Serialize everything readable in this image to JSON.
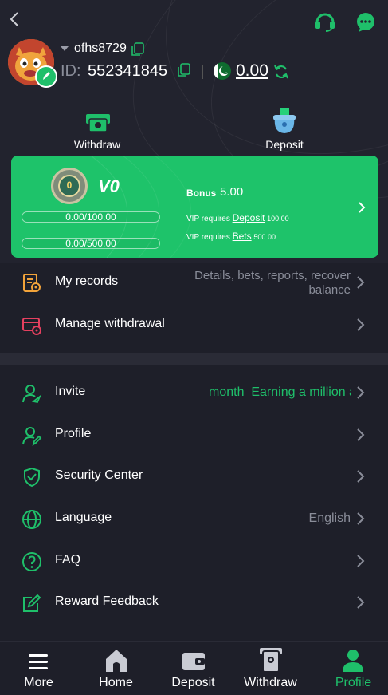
{
  "user": {
    "username": "ofhs8729",
    "id_label": "ID:",
    "id_value": "552341845",
    "balance": "0.00"
  },
  "actions": {
    "withdraw": "Withdraw",
    "deposit": "Deposit"
  },
  "vip": {
    "level": "V0",
    "badge_number": "0",
    "progress_1": "0.00/100.00",
    "progress_2": "0.00/500.00",
    "bonus_label": "Bonus",
    "bonus_value": "5.00",
    "req1_prefix": "VIP requires",
    "req1_link": "Deposit",
    "req1_value": "100.00",
    "req2_prefix": "VIP requires",
    "req2_link": "Bets",
    "req2_value": "500.00"
  },
  "menu1": [
    {
      "label": "My records",
      "extra_line1": "Details, bets, reports, recover",
      "extra_line2": "balance"
    },
    {
      "label": "Manage withdrawal"
    }
  ],
  "menu2": [
    {
      "label": "Invite",
      "extra": "month  Earning a million a"
    },
    {
      "label": "Profile"
    },
    {
      "label": "Security Center"
    },
    {
      "label": "Language",
      "extra": "English"
    },
    {
      "label": "FAQ"
    },
    {
      "label": "Reward Feedback"
    }
  ],
  "nav": [
    {
      "label": "More"
    },
    {
      "label": "Home"
    },
    {
      "label": "Deposit"
    },
    {
      "label": "Withdraw"
    },
    {
      "label": "Profile"
    }
  ],
  "colors": {
    "accent": "#1fbf6a",
    "background": "#1e1f29",
    "card": "#1ec36a"
  }
}
